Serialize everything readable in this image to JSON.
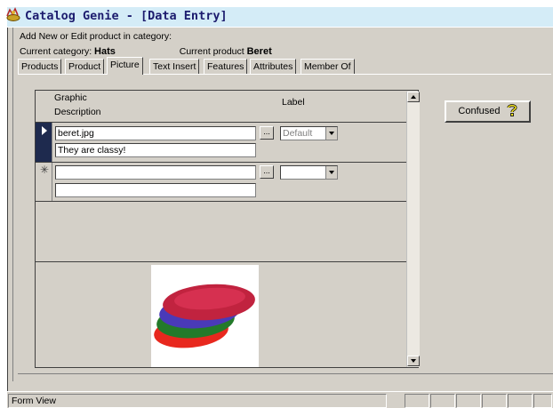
{
  "window": {
    "title": "Catalog Genie - [Data Entry]"
  },
  "header": {
    "instruction": "Add New or Edit product in category:",
    "category_label": "Current category:",
    "category_value": "Hats",
    "product_label": "Current product",
    "product_value": "Beret"
  },
  "tabs": [
    "Products",
    "Product",
    "Picture",
    "Text Insert",
    "Features",
    "Attributes",
    "Member Of"
  ],
  "grid": {
    "col_graphic": "Graphic",
    "col_description": "Description",
    "col_label": "Label",
    "rows": [
      {
        "graphic": "beret.jpg",
        "description": "They are classy!",
        "label": "Default",
        "dots": "..."
      },
      {
        "graphic": "",
        "description": "",
        "label": "",
        "dots": "...",
        "new_marker": "✳"
      }
    ]
  },
  "confused_button": {
    "label": "Confused"
  },
  "icons": {
    "app": "genie-lamp-icon",
    "help": "question-mark-icon",
    "record": "record-pointer-icon"
  },
  "statusbar": {
    "text": "Form View"
  }
}
